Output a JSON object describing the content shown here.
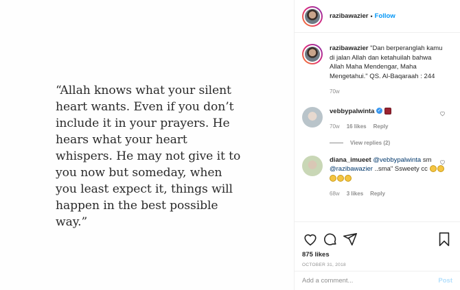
{
  "post": {
    "quote": "“Allah knows what your silent\nheart wants. Even if you don’t\ninclude it in your prayers. He\nhears what your heart\nwhispers. He may not give it to\nyou now but someday, when\nyou least expect it, things will\nhappen in the best possible\nway.”"
  },
  "header": {
    "username": "razibawazier",
    "separator": "•",
    "follow_label": "Follow"
  },
  "caption": {
    "username": "razibawazier",
    "text": " \"Dan berperanglah kamu di jalan Allah dan ketahuilah bahwa Allah Maha Mendengar, Maha Mengetahui.\" QS. Al-Baqaraah : 244",
    "time": "70w"
  },
  "comments": [
    {
      "username": "vebbypalwinta",
      "verified_mark": "✓",
      "emoji": "red-heart-emoji",
      "time": "70w",
      "likes": "16 likes",
      "reply_label": "Reply"
    },
    {
      "username": "diana_imueet",
      "mention1": "@vebbypalwinta",
      "text1": "sm",
      "mention2": "@razibawazier",
      "text2": "..sma\" Ssweety cc",
      "emojis": [
        "smile-emoji",
        "smile-emoji",
        "smile-emoji",
        "smile-emoji",
        "smile-emoji"
      ],
      "time": "68w",
      "likes": "3 likes",
      "reply_label": "Reply"
    }
  ],
  "view_replies": "View replies (2)",
  "actions": {
    "likes": "875 likes",
    "date": "OCTOBER 31, 2018",
    "add_comment_placeholder": "Add a comment...",
    "post_label": "Post"
  },
  "colors": {
    "accent": "#0095f6",
    "muted": "#8e8e8e",
    "text": "#262626"
  }
}
